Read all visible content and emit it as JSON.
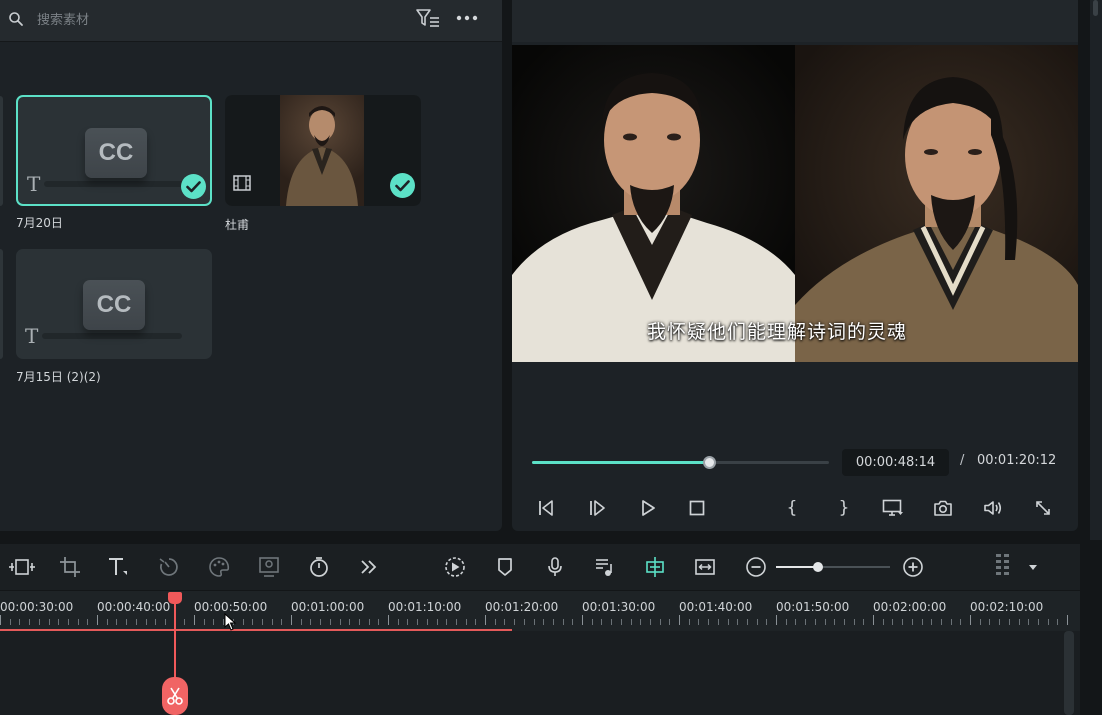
{
  "media": {
    "search_placeholder": "搜索素材",
    "icons": {
      "search": "search-icon",
      "filter": "filter-list-icon",
      "more": "more-dots-icon"
    },
    "clips": [
      {
        "name": "7月20日",
        "kind": "title",
        "badge": "CC",
        "selected": true,
        "used": true
      },
      {
        "name": "杜甫",
        "kind": "video",
        "selected": false,
        "used": true
      },
      {
        "name": "7月15日 (2)(2)",
        "kind": "title",
        "badge": "CC",
        "selected": false,
        "used": false
      }
    ]
  },
  "preview": {
    "subtitle": "我怀疑他们能理解诗词的灵魂",
    "progress": 0.6,
    "current_time": "00:00:48:14",
    "separator": "/",
    "total_time": "00:01:20:12",
    "mark_in": "{",
    "mark_out": "}",
    "controls": [
      "step-back",
      "step-forward",
      "play",
      "stop",
      "mark-in",
      "mark-out",
      "display",
      "snapshot",
      "volume",
      "fullscreen"
    ]
  },
  "toolbar": {
    "tools": [
      "freeze",
      "crop",
      "text",
      "speed",
      "color",
      "ai-portrait",
      "timer",
      "more",
      "render",
      "marker",
      "voiceover",
      "audio-beat",
      "auto-sync",
      "fit",
      "zoom-out",
      "zoom-in",
      "layout",
      "dropdown"
    ],
    "zoom_level": 0.37
  },
  "timeline": {
    "ruler_labels": [
      "00:00:30:00",
      "00:00:40:00",
      "00:00:50:00",
      "00:01:00:00",
      "00:01:10:00",
      "00:01:20:00",
      "00:01:30:00",
      "00:01:40:00",
      "00:01:50:00",
      "00:02:00:00",
      "00:02:10:00"
    ],
    "accent": "#5ce1c7",
    "playhead_color": "#f0595a"
  },
  "colors": {
    "accent": "#5ce1c7",
    "playhead": "#f0595a",
    "panel": "#1d2226",
    "bg": "#131618"
  }
}
